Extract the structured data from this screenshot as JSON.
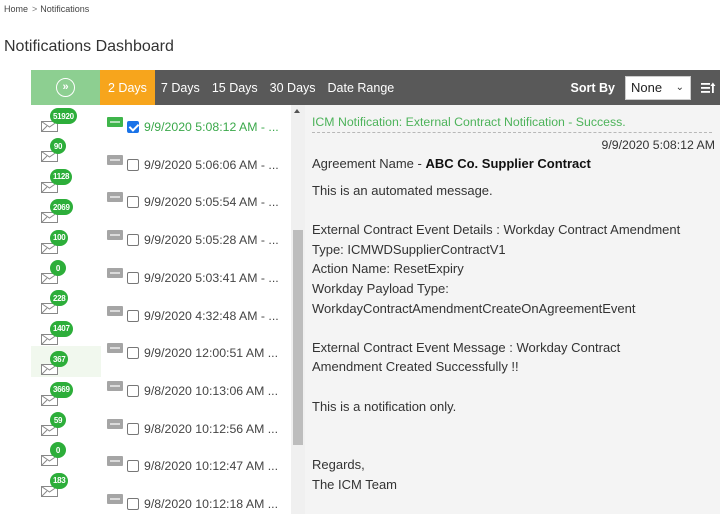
{
  "breadcrumb": {
    "home": "Home",
    "separator": ">",
    "current": "Notifications"
  },
  "page_title": "Notifications Dashboard",
  "colors": {
    "toolbar_bg": "#595959",
    "expand_bg": "#8dcf91",
    "active_tab": "#f7a51c",
    "badge": "#2dae3a",
    "selected_text": "#3aa84a",
    "checkbox": "#1a73e8"
  },
  "toolbar": {
    "expand_icon": "double-chevron-right-icon",
    "tabs": [
      {
        "label": "2 Days",
        "active": true
      },
      {
        "label": "7 Days",
        "active": false
      },
      {
        "label": "15 Days",
        "active": false
      },
      {
        "label": "30 Days",
        "active": false
      },
      {
        "label": "Date Range",
        "active": false
      }
    ],
    "sort_label": "Sort By",
    "sort_value": "None",
    "sort_order_icon": "sort-order-icon"
  },
  "sidebar": {
    "items": [
      {
        "count": "51920",
        "highlight": false
      },
      {
        "count": "90",
        "highlight": false
      },
      {
        "count": "1128",
        "highlight": false
      },
      {
        "count": "2069",
        "highlight": false
      },
      {
        "count": "100",
        "highlight": false
      },
      {
        "count": "0",
        "highlight": false
      },
      {
        "count": "228",
        "highlight": false
      },
      {
        "count": "1407",
        "highlight": false
      },
      {
        "count": "367",
        "highlight": true
      },
      {
        "count": "3669",
        "highlight": false
      },
      {
        "count": "59",
        "highlight": false
      },
      {
        "count": "0",
        "highlight": false
      },
      {
        "count": "183",
        "highlight": false
      }
    ]
  },
  "list": {
    "rows": [
      {
        "timestamp": "9/9/2020 5:08:12 AM - ...",
        "checked": true,
        "selected": true
      },
      {
        "timestamp": "9/9/2020 5:06:06 AM - ...",
        "checked": false,
        "selected": false
      },
      {
        "timestamp": "9/9/2020 5:05:54 AM - ...",
        "checked": false,
        "selected": false
      },
      {
        "timestamp": "9/9/2020 5:05:28 AM - ...",
        "checked": false,
        "selected": false
      },
      {
        "timestamp": "9/9/2020 5:03:41 AM - ...",
        "checked": false,
        "selected": false
      },
      {
        "timestamp": "9/9/2020 4:32:48 AM - ...",
        "checked": false,
        "selected": false
      },
      {
        "timestamp": "9/9/2020 12:00:51 AM ...",
        "checked": false,
        "selected": false
      },
      {
        "timestamp": "9/8/2020 10:13:06 AM ...",
        "checked": false,
        "selected": false
      },
      {
        "timestamp": "9/8/2020 10:12:56 AM ...",
        "checked": false,
        "selected": false
      },
      {
        "timestamp": "9/8/2020 10:12:47 AM ...",
        "checked": false,
        "selected": false
      },
      {
        "timestamp": "9/8/2020 10:12:18 AM ...",
        "checked": false,
        "selected": false
      }
    ]
  },
  "detail": {
    "subject": "ICM Notification: External Contract Notification - Success.",
    "date": "9/9/2020 5:08:12 AM",
    "agreement_label": "Agreement Name - ",
    "agreement_name": "ABC Co. Supplier Contract",
    "body_lines": [
      "This is an automated message.",
      "",
      "External Contract Event Details : Workday Contract Amendment",
      "Type: ICMWDSupplierContractV1",
      "Action Name: ResetExpiry",
      "Workday Payload Type:",
      "WorkdayContractAmendmentCreateOnAgreementEvent",
      "",
      "External Contract Event Message :  Workday Contract",
      "Amendment Created Successfully !!",
      "",
      "This is a notification only.",
      "",
      "",
      "Regards,",
      "The ICM Team"
    ]
  }
}
